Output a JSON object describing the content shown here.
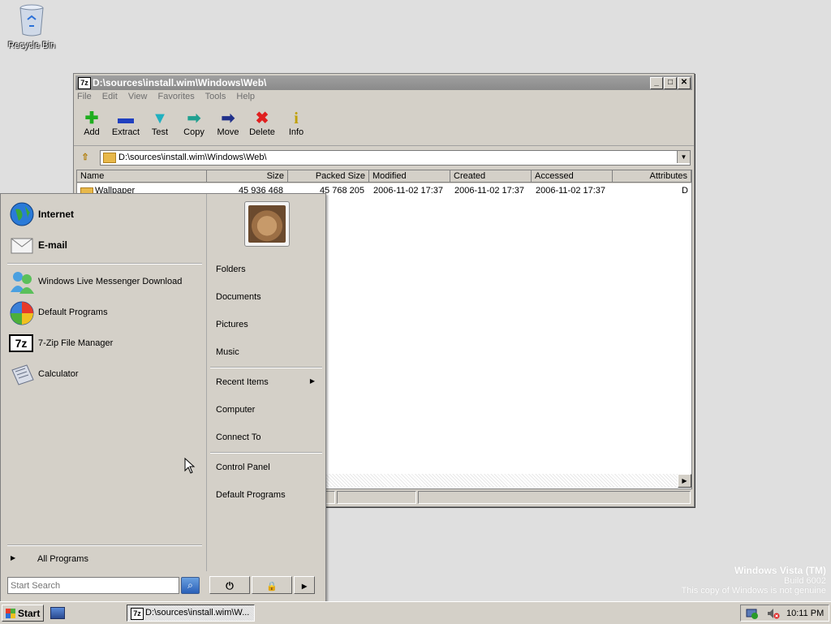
{
  "desktop": {
    "recycle_bin_label": "Recycle Bin",
    "watermark": {
      "line1": "Windows Vista (TM)",
      "line2": "Build 6002",
      "line3": "This copy of Windows is not genuine"
    }
  },
  "window": {
    "title": "D:\\sources\\install.wim\\Windows\\Web\\",
    "app_icon_text": "7z",
    "controls": {
      "minimize": "_",
      "maximize": "□",
      "close": "✕"
    },
    "menu": [
      "File",
      "Edit",
      "View",
      "Favorites",
      "Tools",
      "Help"
    ],
    "toolbar": [
      {
        "label": "Add",
        "icon": "plus-icon",
        "glyph": "✚",
        "color": "#1fae1f"
      },
      {
        "label": "Extract",
        "icon": "minus-icon",
        "glyph": "▬",
        "color": "#2040c0"
      },
      {
        "label": "Test",
        "icon": "check-icon",
        "glyph": "▼",
        "color": "#20b0c0"
      },
      {
        "label": "Copy",
        "icon": "copy-arrow-icon",
        "glyph": "➡",
        "color": "#20a090"
      },
      {
        "label": "Move",
        "icon": "move-arrow-icon",
        "glyph": "➡",
        "color": "#20308a"
      },
      {
        "label": "Delete",
        "icon": "delete-x-icon",
        "glyph": "✖",
        "color": "#e02020"
      },
      {
        "label": "Info",
        "icon": "info-icon",
        "glyph": "i",
        "color": "#c0a000"
      }
    ],
    "address": "D:\\sources\\install.wim\\Windows\\Web\\",
    "columns": [
      "Name",
      "Size",
      "Packed Size",
      "Modified",
      "Created",
      "Accessed",
      "Attributes"
    ],
    "rows": [
      {
        "name": "Wallpaper",
        "size": "45 936 468",
        "packed_size": "45 768 205",
        "modified": "2006-11-02 17:37",
        "created": "2006-11-02 17:37",
        "accessed": "2006-11-02 17:37",
        "attributes": "D"
      }
    ]
  },
  "start_menu": {
    "pinned": [
      {
        "label": "Internet",
        "icon": "globe-icon"
      },
      {
        "label": "E-mail",
        "icon": "envelope-icon"
      }
    ],
    "recent": [
      {
        "label": "Windows Live Messenger Download",
        "icon": "messenger-icon"
      },
      {
        "label": "Default Programs",
        "icon": "default-programs-icon"
      },
      {
        "label": "7-Zip File Manager",
        "icon": "sevenzip-icon",
        "icon_text": "7z"
      },
      {
        "label": "Calculator",
        "icon": "calculator-icon"
      }
    ],
    "all_programs": "All Programs",
    "right_group1": [
      "Folders",
      "Documents",
      "Pictures",
      "Music"
    ],
    "right_group2": [
      "Recent Items",
      "Computer",
      "Connect To"
    ],
    "right_group3": [
      "Control Panel",
      "Default Programs"
    ],
    "search_placeholder": "Start Search",
    "power_glyph": "⏻",
    "lock_glyph": "🔒",
    "more_glyph": "▸"
  },
  "taskbar": {
    "start_label": "Start",
    "task_title": "D:\\sources\\install.wim\\W...",
    "task_icon_text": "7z",
    "clock": "10:11 PM"
  },
  "colors": {
    "window_bg": "#d4d0c8",
    "desktop_bg": "#dfdfdf",
    "search_button": "#2a60b8"
  }
}
